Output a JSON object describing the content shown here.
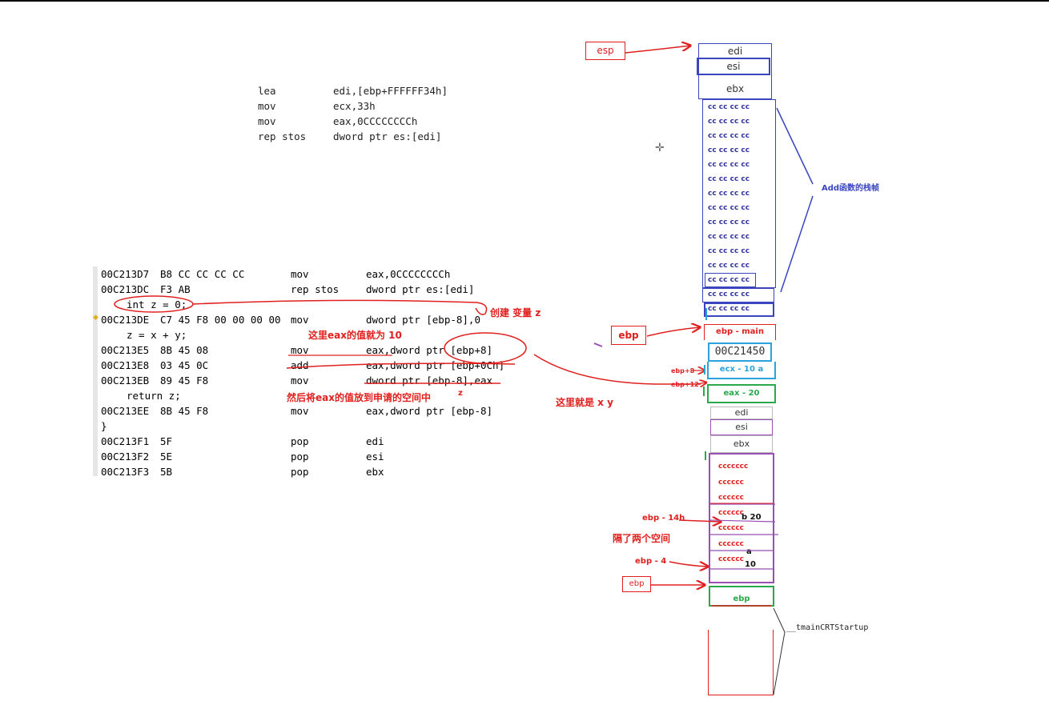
{
  "top_asm": [
    {
      "op": "lea",
      "args": "edi,[ebp+FFFFFF34h]"
    },
    {
      "op": "mov",
      "args": "ecx,33h"
    },
    {
      "op": "mov",
      "args": "eax,0CCCCCCCCh"
    },
    {
      "op": "rep stos",
      "args": "dword ptr es:[edi]"
    }
  ],
  "code_rows": [
    {
      "addr": "00C213D7",
      "bytes": "B8 CC CC CC CC",
      "op": "mov",
      "args": "eax,0CCCCCCCCh"
    },
    {
      "addr": "00C213DC",
      "bytes": "F3 AB",
      "op": "rep stos",
      "args": "dword ptr es:[edi]"
    },
    {
      "src": "int z = 0;"
    },
    {
      "addr": "00C213DE",
      "bytes": "C7 45 F8 00 00 00 00",
      "op": "mov",
      "args": "dword ptr [ebp-8],0"
    },
    {
      "src": "z = x + y;"
    },
    {
      "addr": "00C213E5",
      "bytes": "8B 45 08",
      "op": "mov",
      "args": "eax,dword ptr [ebp+8]"
    },
    {
      "addr": "00C213E8",
      "bytes": "03 45 0C",
      "op": "add",
      "args": "eax,dword ptr [ebp+0Ch]"
    },
    {
      "addr": "00C213EB",
      "bytes": "89 45 F8",
      "op": "mov",
      "args": "dword ptr [ebp-8],eax"
    },
    {
      "src": "return z;"
    },
    {
      "addr": "00C213EE",
      "bytes": "8B 45 F8",
      "op": "mov",
      "args": "eax,dword ptr [ebp-8]"
    },
    {
      "src": "}"
    },
    {
      "addr": "00C213F1",
      "bytes": "5F",
      "op": "pop",
      "args": "edi"
    },
    {
      "addr": "00C213F2",
      "bytes": "5E",
      "op": "pop",
      "args": "esi"
    },
    {
      "addr": "00C213F3",
      "bytes": "5B",
      "op": "pop",
      "args": "ebx"
    }
  ],
  "annotations": {
    "create_var": "创建 变量 z",
    "eax_value": "这里eax的值就为 10",
    "put_eax": "然后将eax的值放到申请的空间中",
    "z_mark": "z",
    "here_xy": "这里就是 x y",
    "two_spaces": "隔了两个空间",
    "add_frame": "Add函数的栈帧",
    "tmain": "__tmainCRTStartup"
  },
  "stack_top": {
    "esp_label": "esp",
    "edi": "edi",
    "esi": "esi",
    "ebx": "ebx",
    "cc_rows": [
      "cc cc cc cc",
      "cc cc cc cc",
      "cc cc cc cc",
      "cc cc cc cc",
      "cc cc cc cc",
      "cc cc cc cc",
      "cc cc cc cc",
      "cc cc cc cc",
      "cc cc cc cc",
      "cc cc cc cc",
      "cc cc cc cc",
      "cc cc cc cc",
      "cc cc cc cc",
      "cc cc cc cc",
      "cc cc cc cc"
    ]
  },
  "stack_mid": {
    "ebp_label": "ebp",
    "ebp_main": "ebp - main",
    "ret_addr": "00C21450",
    "ebp_plus8": "ebp+8",
    "ebp_plus12": "ebp+12",
    "ecx": "ecx - 10  a",
    "eax": "eax - 20",
    "edi": "edi",
    "esi": "esi",
    "ebx": "ebx"
  },
  "stack_low": {
    "c_rows": [
      "ccccccc",
      "cccccc",
      "cccccc",
      "cccccc",
      "cccccc",
      "cccccc",
      "cccccc"
    ],
    "ebp_minus14": "ebp - 14h",
    "ebp_minus4": "ebp - 4",
    "b_val": "b 20",
    "a_lbl": "a",
    "a_val": "10",
    "ebp_box": "ebp",
    "ebp_green": "ebp"
  },
  "colors": {
    "annotation_red": "#e0201e",
    "frame_blue": "#3a46c0",
    "cyan": "#29a3d9",
    "green": "#2aa84a",
    "purple": "#9b4fb5"
  }
}
